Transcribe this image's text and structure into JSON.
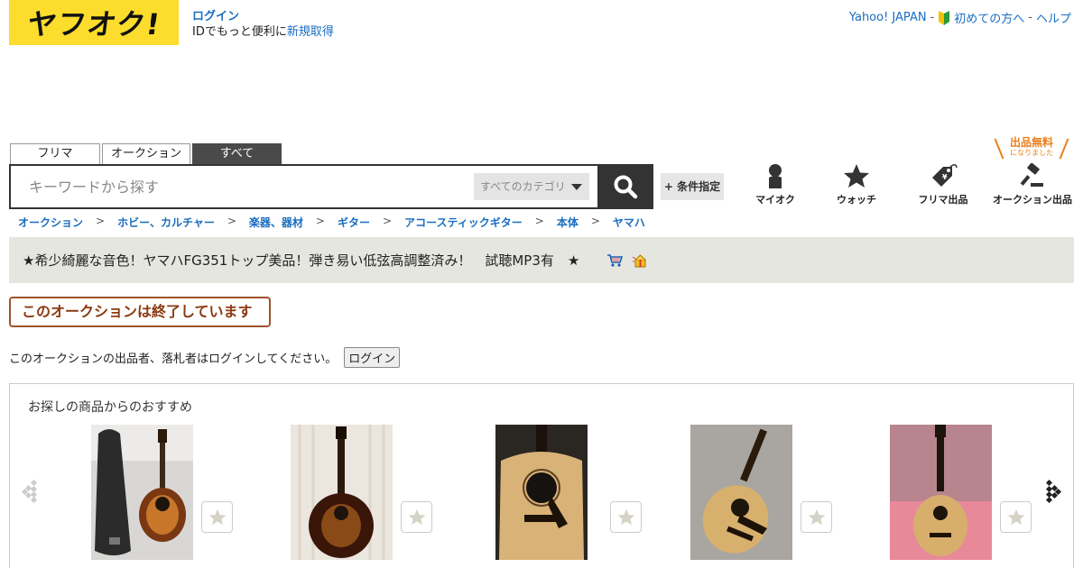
{
  "header": {
    "logo_text": "ヤフオク!",
    "login_link": "ログイン",
    "login_sub_prefix": "IDでもっと便利に",
    "register_link": "新規取得",
    "top_links": [
      "Yahoo! JAPAN",
      "初めての方へ",
      "ヘルプ"
    ],
    "separator": "-"
  },
  "search": {
    "tabs": [
      "フリマ",
      "オークション",
      "すべて"
    ],
    "active_tab": "すべて",
    "placeholder": "キーワードから探す",
    "category": "すべてのカテゴリ",
    "condition_button": "+ 条件指定"
  },
  "nav": {
    "items": [
      {
        "label": "マイオク",
        "icon": "person-icon"
      },
      {
        "label": "ウォッチ",
        "icon": "star-icon"
      },
      {
        "label": "フリマ出品",
        "icon": "price-tag-icon"
      },
      {
        "label": "オークション出品",
        "icon": "gavel-icon"
      }
    ],
    "free_badge_line1": "出品無料",
    "free_badge_line2": "になりました"
  },
  "breadcrumb": [
    "オークション",
    "ホビー、カルチャー",
    "楽器、器材",
    "ギター",
    "アコースティックギター",
    "本体",
    "ヤマハ"
  ],
  "breadcrumb_separator": ">",
  "item": {
    "title": "★希少綺麗な音色！ヤマハFG351トップ美品！弾き易い低弦高調整済み！　試聴MP3有　★",
    "ended_label": "このオークションは終了しています",
    "notice_text": "このオークションの出品者、落札者はログインしてください。",
    "login_button": "ログイン"
  },
  "recommend": {
    "title": "お探しの商品からのおすすめ",
    "items": [
      {
        "image": "guitar-with-case-sunburst"
      },
      {
        "image": "guitar-sunburst-dreadnought"
      },
      {
        "image": "guitar-natural-closeup"
      },
      {
        "image": "guitar-natural-on-carpet"
      },
      {
        "image": "guitar-natural-pink-background"
      }
    ]
  },
  "colors": {
    "logo_yellow": "#fcdc2c",
    "link_blue": "#1a6dc0",
    "ended_border": "#a0522d",
    "badge_orange": "#e8801a"
  }
}
